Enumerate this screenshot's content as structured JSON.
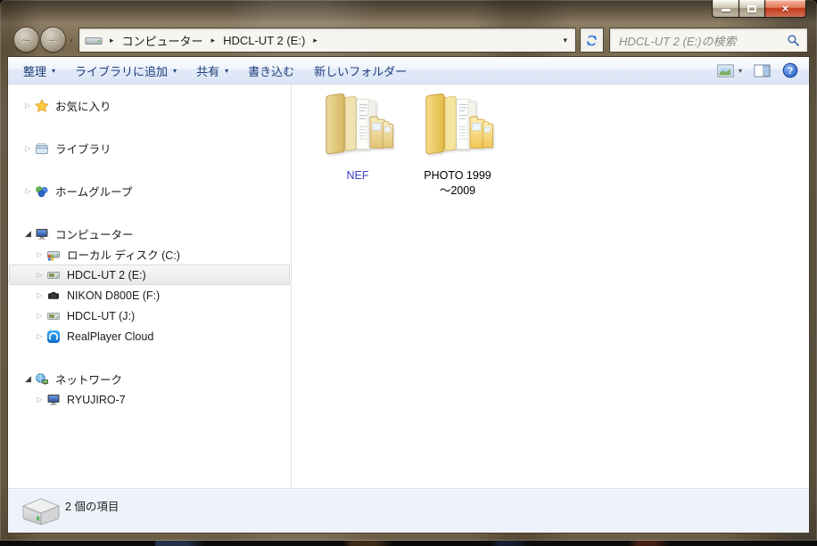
{
  "titlebar": {
    "buttons": {
      "minimize": "minimize",
      "maximize": "maximize",
      "close": "close",
      "close_glyph": "×"
    }
  },
  "navigation": {
    "back_glyph": "←",
    "forward_glyph": "→",
    "breadcrumb": {
      "root_icon": "drive-icon",
      "items": [
        {
          "label": "コンピューター"
        },
        {
          "label": "HDCL-UT 2 (E:)"
        }
      ],
      "separator_glyph": "▸",
      "dropdown_glyph": "▾"
    },
    "refresh_icon": "refresh-icon",
    "search": {
      "placeholder": "HDCL-UT 2 (E:)の検索",
      "icon": "magnifier-icon"
    }
  },
  "toolbar": {
    "items": [
      {
        "label": "整理",
        "dropdown": true
      },
      {
        "label": "ライブラリに追加",
        "dropdown": true
      },
      {
        "label": "共有",
        "dropdown": true
      },
      {
        "label": "書き込む",
        "dropdown": false
      },
      {
        "label": "新しいフォルダー",
        "dropdown": false
      }
    ],
    "dropdown_glyph": "▾",
    "right_icons": [
      "views-icon",
      "views-dropdown",
      "preview-pane-icon",
      "help-icon"
    ]
  },
  "sidebar": {
    "items": [
      {
        "label": "お気に入り",
        "icon": "star-icon",
        "level": 0,
        "state": "collapsed",
        "selected": false
      },
      {
        "label": "ライブラリ",
        "icon": "libraries-icon",
        "level": 0,
        "state": "collapsed",
        "selected": false
      },
      {
        "label": "ホームグループ",
        "icon": "homegroup-icon",
        "level": 0,
        "state": "collapsed",
        "selected": false
      },
      {
        "label": "コンピューター",
        "icon": "computer-icon",
        "level": 0,
        "state": "expanded",
        "selected": false
      },
      {
        "label": "ローカル ディスク (C:)",
        "icon": "system-drive-icon",
        "level": 1,
        "state": "collapsed",
        "selected": false
      },
      {
        "label": "HDCL-UT 2 (E:)",
        "icon": "external-drive-icon",
        "level": 1,
        "state": "collapsed",
        "selected": true
      },
      {
        "label": "NIKON D800E (F:)",
        "icon": "camera-icon",
        "level": 1,
        "state": "collapsed",
        "selected": false
      },
      {
        "label": "HDCL-UT (J:)",
        "icon": "external-drive-icon",
        "level": 1,
        "state": "collapsed",
        "selected": false
      },
      {
        "label": "RealPlayer Cloud",
        "icon": "realplayer-cloud-icon",
        "level": 1,
        "state": "collapsed",
        "selected": false
      },
      {
        "label": "ネットワーク",
        "icon": "network-icon",
        "level": 0,
        "state": "expanded",
        "selected": false
      },
      {
        "label": "RYUJIRO-7",
        "icon": "computer-icon",
        "level": 1,
        "state": "collapsed",
        "selected": false
      }
    ],
    "collapsed_glyph": "▷",
    "expanded_glyph": "◢"
  },
  "files": {
    "items": [
      {
        "name": "NEF",
        "lines": [
          "NEF"
        ],
        "compressed": true,
        "icon": "folder-icon"
      },
      {
        "name": "PHOTO 1999～2009",
        "lines": [
          "PHOTO 1999",
          "～2009"
        ],
        "compressed": false,
        "icon": "folder-icon"
      }
    ]
  },
  "statusbar": {
    "text": "2 個の項目",
    "icon": "hard-drive-icon"
  },
  "colors": {
    "frame_glass": "#83745c",
    "toolbar_text": "#1f3d7a",
    "close_button_red": "#c23a1b",
    "compressed_file_name": "#3c3ccd",
    "selection_fill": "#ededed",
    "help_icon_blue": "#2a62c9",
    "statusbar_bg": "#eef2fa"
  }
}
